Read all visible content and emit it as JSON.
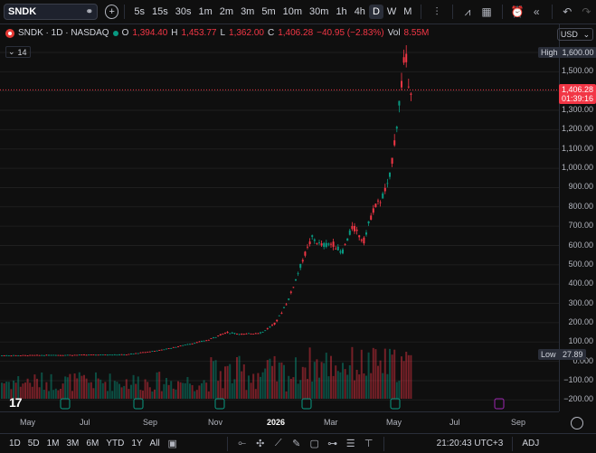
{
  "toolbar": {
    "symbol": "SNDK",
    "timeframes": [
      "5s",
      "15s",
      "30s",
      "1m",
      "2m",
      "3m",
      "5m",
      "10m",
      "30m",
      "1h",
      "4h",
      "D",
      "W",
      "M"
    ],
    "active_timeframe": "D"
  },
  "legend": {
    "title": "SNDK · 1D · NASDAQ",
    "o_label": "O",
    "o": "1,394.40",
    "h_label": "H",
    "h": "1,453.77",
    "l_label": "L",
    "l": "1,362.00",
    "c_label": "C",
    "c": "1,406.28",
    "change": "−40.95 (−2.83%)",
    "vol_label": "Vol",
    "vol": "8.55M",
    "indicator_count": "14"
  },
  "currency": "USD",
  "price_axis": {
    "ticks": [
      "1,600.00",
      "1,500.00",
      "1,400.00",
      "1,300.00",
      "1,200.00",
      "1,100.00",
      "1,000.00",
      "900.00",
      "800.00",
      "700.00",
      "600.00",
      "500.00",
      "400.00",
      "300.00",
      "200.00",
      "100.00",
      "0.000",
      "−100.00",
      "−200.00"
    ],
    "high_label": "High",
    "high_value": "1,600.00",
    "last_price": "1,406.28",
    "countdown": "01:39:16",
    "low_label": "Low",
    "low_value": "27.89"
  },
  "time_axis": [
    "May",
    "Jul",
    "Sep",
    "Nov",
    "2026",
    "Mar",
    "May",
    "Jul",
    "Sep"
  ],
  "bottom": {
    "ranges": [
      "1D",
      "5D",
      "1M",
      "3M",
      "6M",
      "YTD",
      "1Y",
      "All"
    ],
    "clock": "21:20:43 UTC+3",
    "adj": "ADJ"
  },
  "colors": {
    "up": "#089981",
    "down": "#f23645",
    "background": "#0f0f0f",
    "grid": "#1f1f1f"
  },
  "icons": [
    "dropdown-icon",
    "add-symbol-icon",
    "candles-icon",
    "indicators-icon",
    "templates-icon",
    "alert-icon",
    "replay-icon",
    "undo-icon",
    "redo-icon",
    "settings-icon",
    "calendar-icon",
    "tradingview-logo"
  ]
}
